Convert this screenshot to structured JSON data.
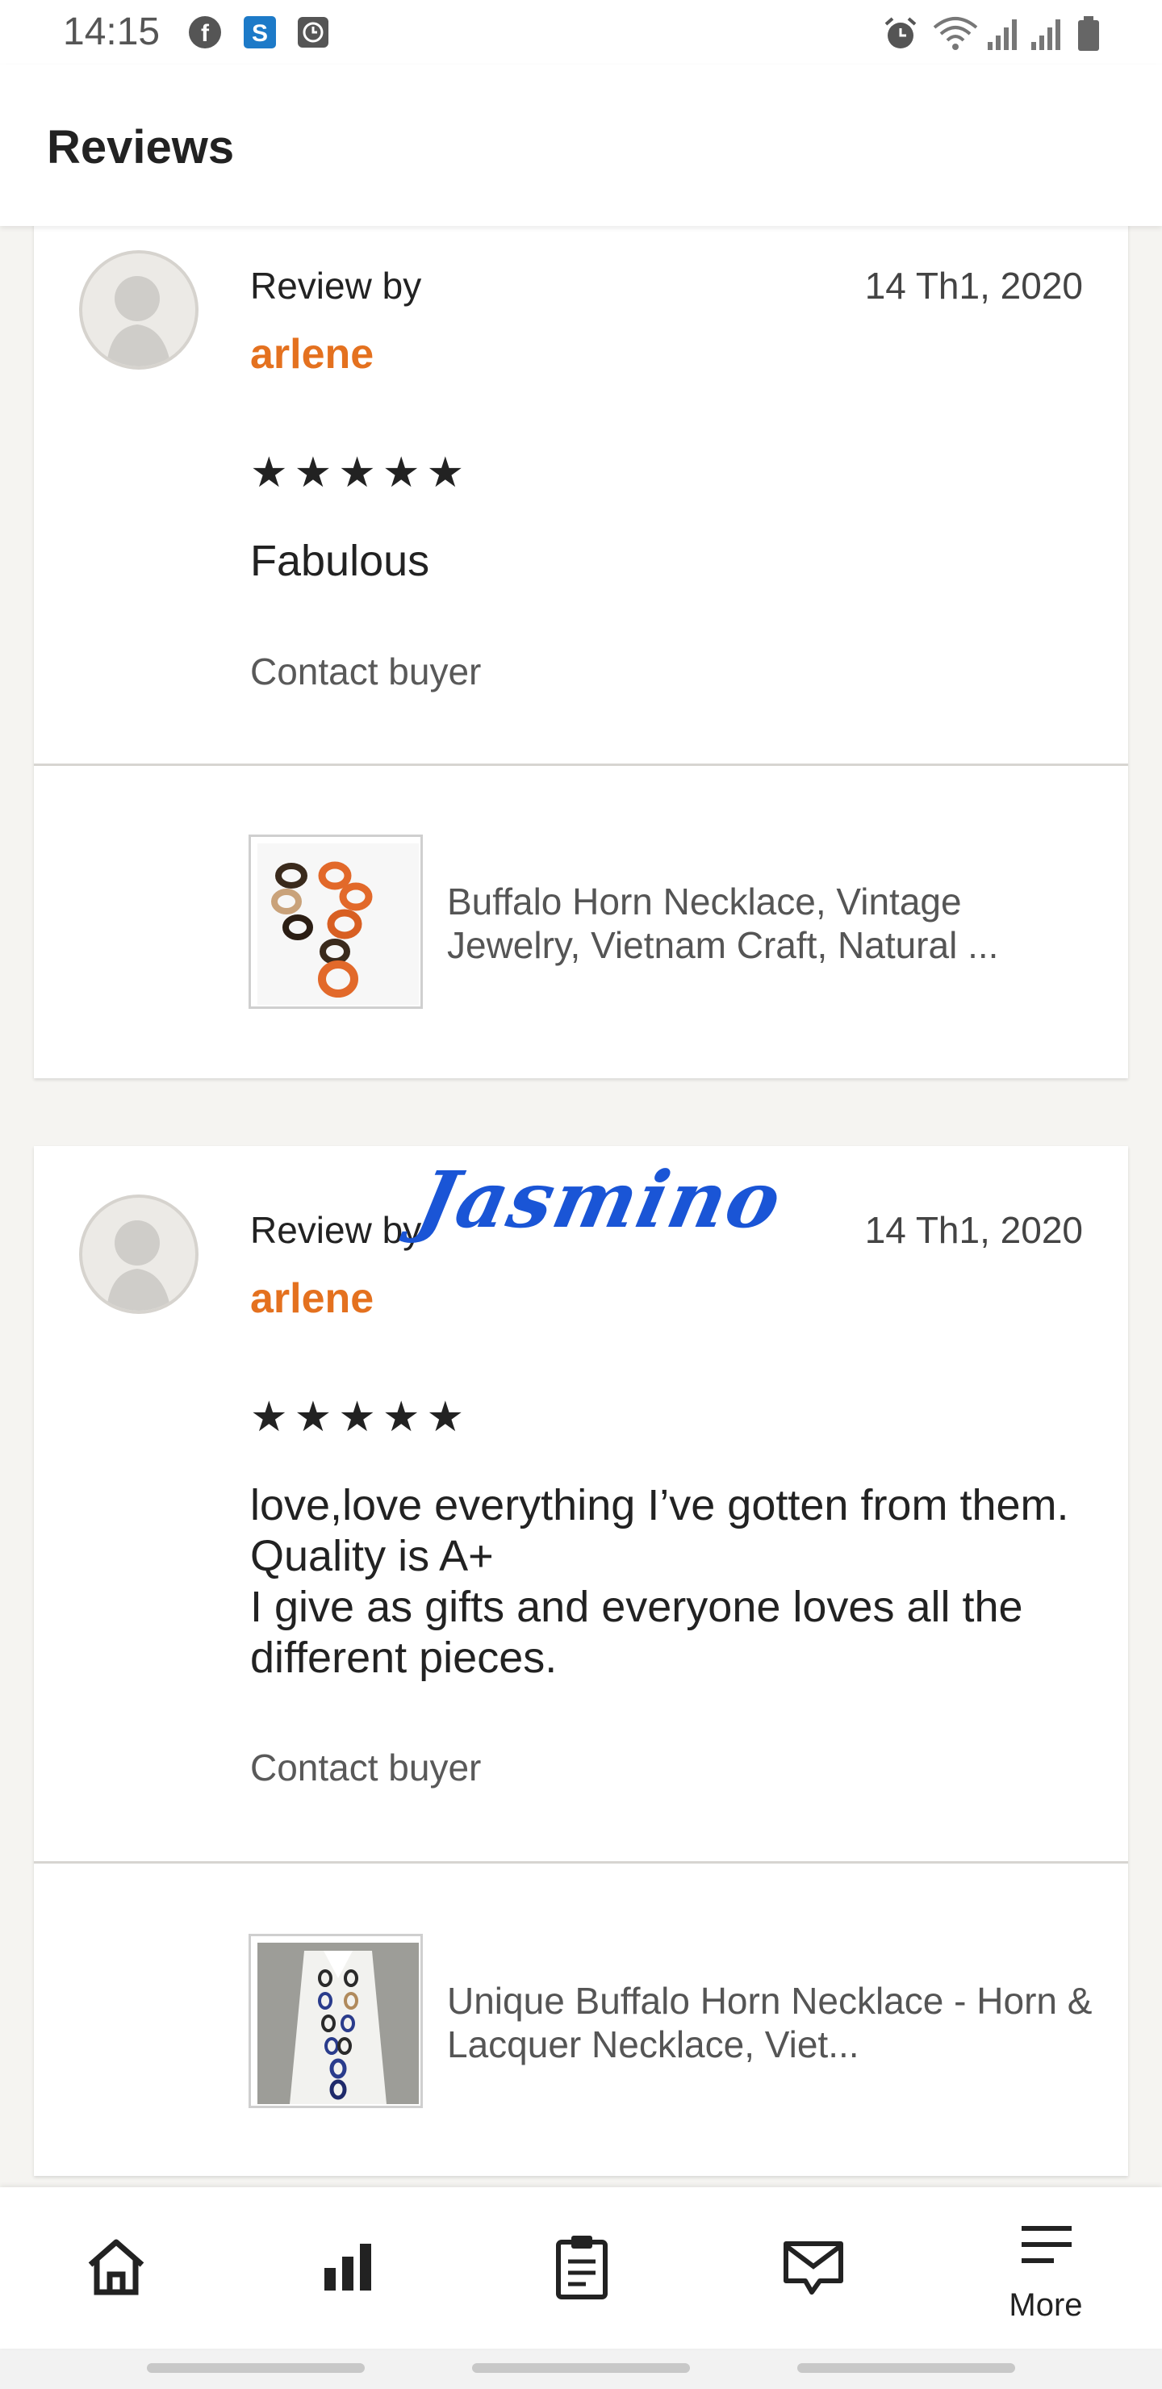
{
  "status_bar": {
    "time": "14:15",
    "left_icons": [
      "facebook-icon",
      "skype-icon",
      "clock-app-icon"
    ],
    "right_icons": [
      "alarm-icon",
      "wifi-icon",
      "signal-icon",
      "signal-icon-2",
      "battery-icon"
    ]
  },
  "header": {
    "title": "Reviews"
  },
  "reviews": [
    {
      "review_by": "Review by",
      "reviewer": "arlene",
      "date": "14 Th1, 2020",
      "stars": "★★★★★",
      "rating": 5,
      "text": "Fabulous",
      "contact": "Contact buyer",
      "product_title": "Buffalo Horn Necklace, Vintage Jewelry, Vietnam Craft, Natural ..."
    },
    {
      "review_by": "Review by",
      "reviewer": "arlene",
      "date": "14 Th1, 2020",
      "stars": "★★★★★",
      "rating": 5,
      "text": "love,love everything I’ve gotten from them. Quality is A+\nI give as gifts and everyone loves all the different pieces.",
      "contact": "Contact buyer",
      "product_title": "Unique Buffalo Horn Necklace - Horn & Lacquer Necklace, Viet..."
    }
  ],
  "signature": "Jasmino",
  "bottom_nav": [
    {
      "icon": "home-icon",
      "label": ""
    },
    {
      "icon": "stats-icon",
      "label": ""
    },
    {
      "icon": "orders-icon",
      "label": ""
    },
    {
      "icon": "messages-icon",
      "label": ""
    },
    {
      "icon": "menu-icon",
      "label": "More"
    }
  ],
  "colors": {
    "accent": "#e4711f",
    "background": "#f5f4f1",
    "signature": "#1a55d6"
  }
}
